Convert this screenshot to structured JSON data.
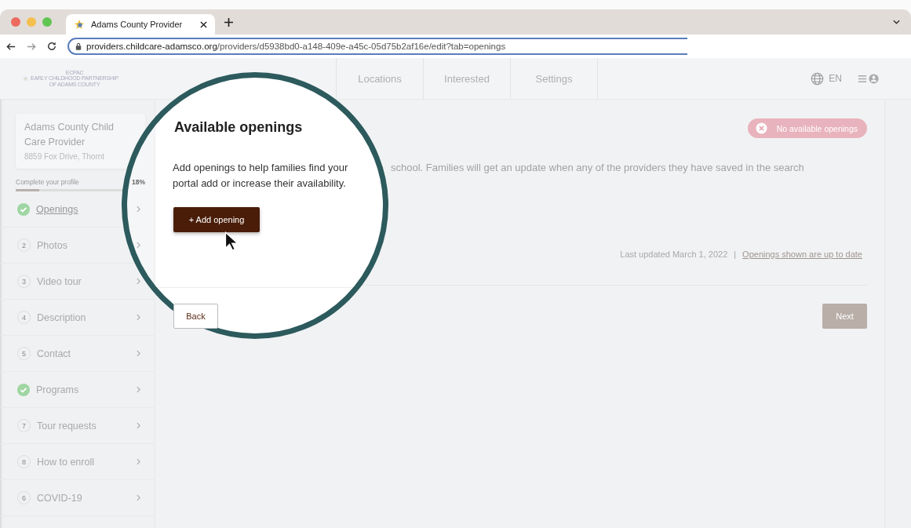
{
  "browser": {
    "tab": {
      "title": "Adams County Provider",
      "selected": true
    },
    "address": {
      "host": "providers.childcare-adamsco.org",
      "path": "/providers/d5938bd0-a148-409e-a45c-05d75b2af16e/edit?tab=openings",
      "focused": true
    }
  },
  "header": {
    "logo": [
      "ECPAC",
      "EARLY CHILDHOOD PARTNERSHIP",
      "OF ADAMS COUNTY"
    ],
    "nav": [
      {
        "label": "Locations"
      },
      {
        "label": "Interested"
      },
      {
        "label": "Settings"
      }
    ],
    "language": "EN"
  },
  "sidebar": {
    "provider": {
      "name": "Adams County Child Care Provider",
      "address": "8859 Fox Drive, Thornt"
    },
    "progress": {
      "label": "Complete your profile",
      "percent": "18%",
      "level": 0.18
    },
    "steps": [
      {
        "label": "Openings",
        "completed": true,
        "selected": true
      },
      {
        "label": "Photos",
        "number": "2",
        "completed": false,
        "selected": false
      },
      {
        "label": "Video tour",
        "number": "3",
        "completed": false,
        "selected": false
      },
      {
        "label": "Description",
        "number": "4",
        "completed": false,
        "selected": false
      },
      {
        "label": "Contact",
        "number": "5",
        "completed": false,
        "selected": false
      },
      {
        "label": "Programs",
        "completed": true,
        "selected": false
      },
      {
        "label": "Tour requests",
        "number": "7",
        "completed": false,
        "selected": false
      },
      {
        "label": "How to enroll",
        "number": "8",
        "completed": false,
        "selected": false
      },
      {
        "label": "COVID-19",
        "number": "6",
        "completed": false,
        "selected": false
      }
    ]
  },
  "main": {
    "title": "Available openings",
    "intro": [
      "Add openings to help families find your",
      "school. Families will get an update when any of the providers they have saved in the search",
      "portal add or increase their availability."
    ],
    "add_button": "+ Add opening",
    "status": {
      "label": "No available openings",
      "kind": "none"
    },
    "last_updated": "Last updated March 1, 2022",
    "separator": "|",
    "confirm_link": "Openings shown are up to date",
    "back_button": "Back",
    "next_button": "Next"
  }
}
